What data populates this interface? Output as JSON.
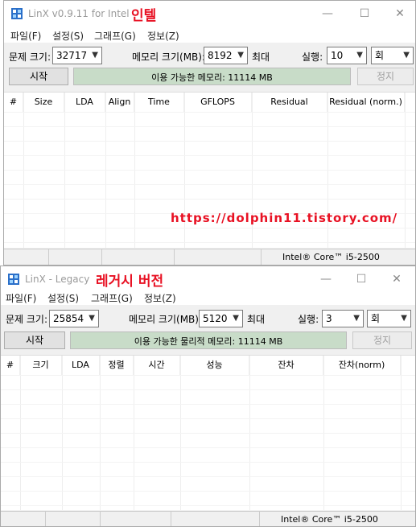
{
  "window1": {
    "title": "LinX v0.9.11 for Intel",
    "badge": "인텔",
    "menu": [
      "파일(F)",
      "설정(S)",
      "그래프(G)",
      "정보(Z)"
    ],
    "problem_size_label": "문제 크기:",
    "problem_size_value": "32717",
    "memory_label": "메모리 크기(MB):",
    "memory_value": "8192",
    "memory_max_label": "최대",
    "run_label": "실행:",
    "run_value": "10",
    "run_unit": "회",
    "start_button": "시작",
    "stop_button": "정지",
    "progress_text": "이용 가능한 메모리: 11114 MB",
    "columns": [
      "#",
      "Size",
      "LDA",
      "Align",
      "Time",
      "GFLOPS",
      "Residual",
      "Residual (norm.)"
    ],
    "cpu": "Intel® Core™ i5-2500"
  },
  "url_text": "https://dolphin11.tistory.com/",
  "window2": {
    "title": "LinX - Legacy",
    "badge": "레거시 버전",
    "menu": [
      "파일(F)",
      "설정(S)",
      "그래프(G)",
      "정보(Z)"
    ],
    "problem_size_label": "문제 크기:",
    "problem_size_value": "25854",
    "memory_label": "메모리 크기(MB):",
    "memory_value": "5120",
    "memory_max_label": "최대",
    "run_label": "실행:",
    "run_value": "3",
    "run_unit": "회",
    "start_button": "시작",
    "stop_button": "정지",
    "progress_text": "이용 가능한 물리적 메모리: 11114 MB",
    "columns": [
      "#",
      "크기",
      "LDA",
      "정렬",
      "시간",
      "성능",
      "잔차",
      "잔차(norm)"
    ],
    "cpu": "Intel® Core™ i5-2500"
  },
  "icons": {
    "app": "linx-app-icon",
    "minimize": "minimize-icon",
    "maximize": "maximize-icon",
    "close": "close-icon",
    "dropdown": "chevron-down-icon"
  },
  "colors": {
    "badge": "#e81123",
    "progress_fill": "#c8dcc8"
  }
}
